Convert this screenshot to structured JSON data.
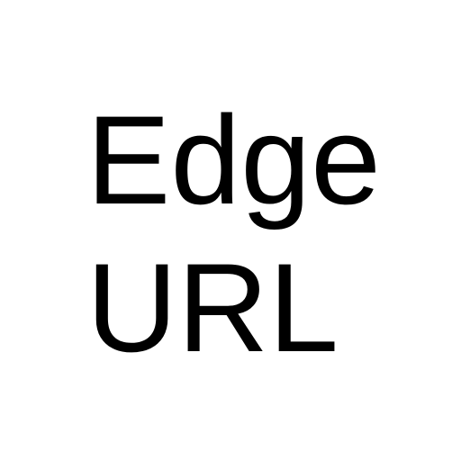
{
  "icon": {
    "line1": "Edge",
    "line2": "URL",
    "text_color": "#000000",
    "background_color": "#ffffff"
  }
}
